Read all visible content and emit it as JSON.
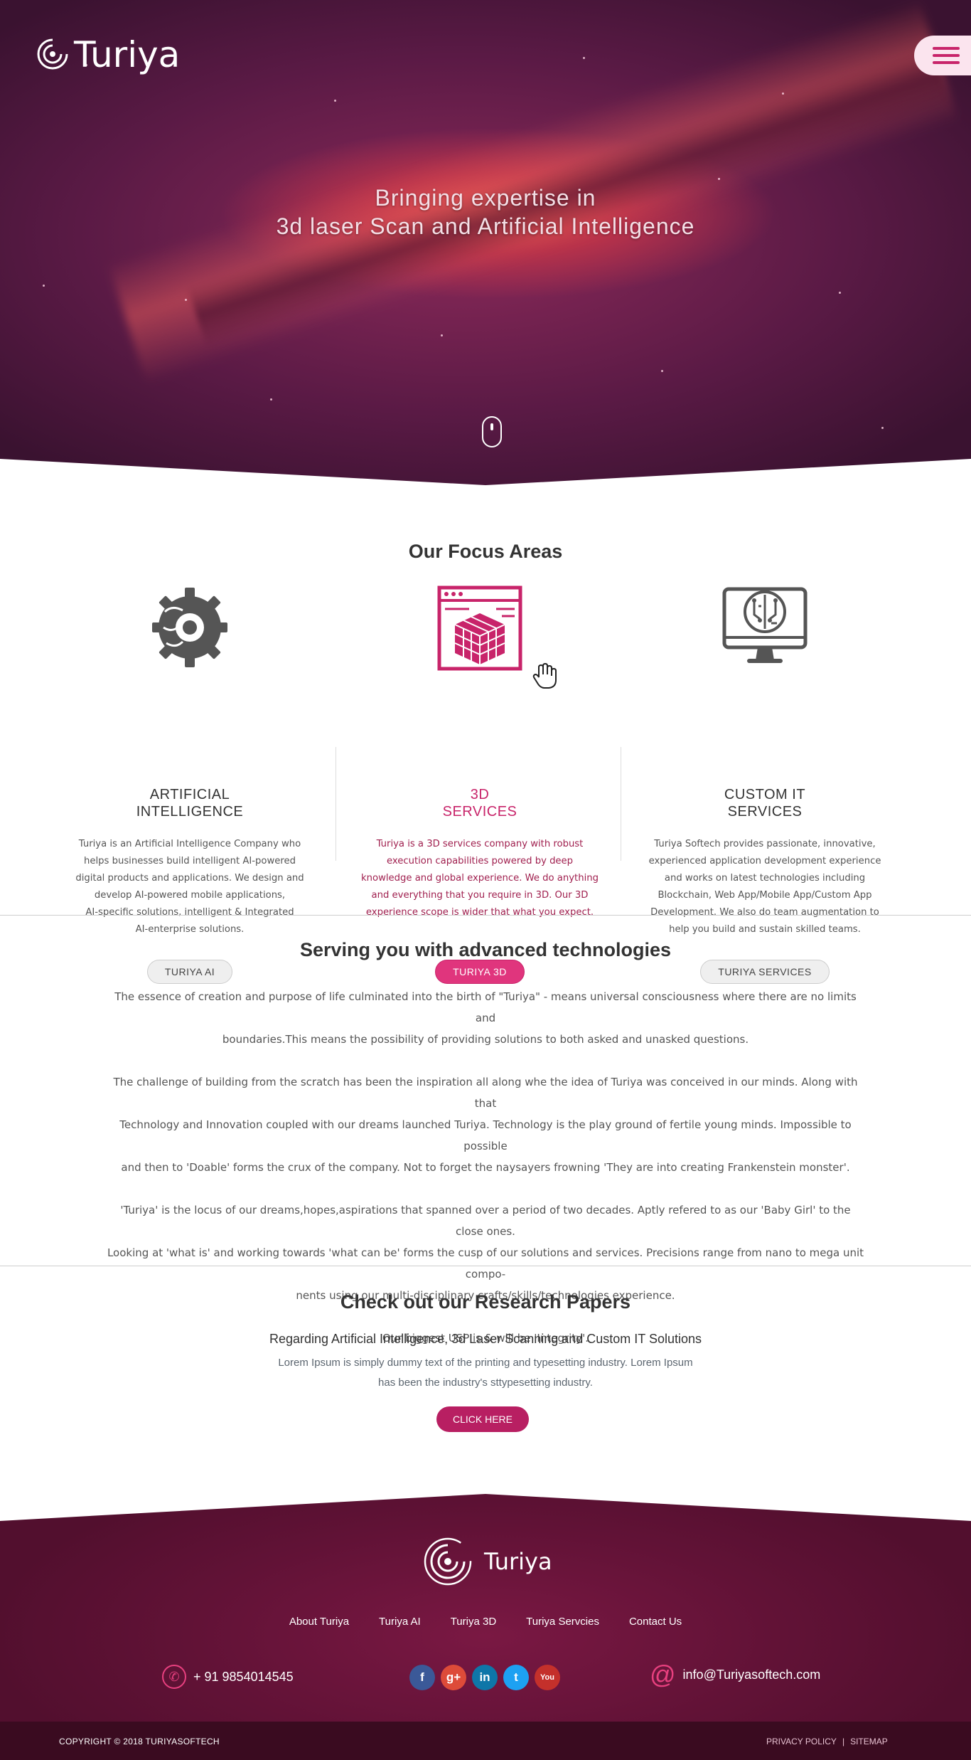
{
  "header": {
    "brand": "Turiya",
    "hero_line1": "Bringing expertise in",
    "hero_line2": "3d laser Scan and Artificial Intelligence"
  },
  "focus": {
    "title": "Our Focus Areas",
    "items": [
      {
        "title_line1": "ARTIFICIAL",
        "title_line2": "INTELLIGENCE",
        "desc_lines": [
          "Turiya is an Artificial Intelligence Company who",
          "helps businesses build intelligent AI-powered",
          "digital products and applications. We design and",
          "develop AI-powered mobile applications,",
          "AI-specific solutions, intelligent & Integrated",
          "AI-enterprise solutions."
        ],
        "button": "TURIYA AI",
        "icon": "ai-brain-gear-icon"
      },
      {
        "title_line1": "3D",
        "title_line2": "SERVICES",
        "desc_lines": [
          "Turiya is a 3D services company with robust",
          "execution capabilities powered by deep",
          "knowledge and global experience. We do anything",
          "and everything that you require in 3D. Our 3D",
          "experience scope is wider that what you expect."
        ],
        "button": "TURIYA 3D",
        "icon": "3d-cube-window-icon"
      },
      {
        "title_line1": "CUSTOM IT",
        "title_line2": "SERVICES",
        "desc_lines": [
          "Turiya Softech provides passionate, innovative,",
          "experienced application development experience",
          "and works on latest technologies including",
          "Blockchain, Web App/Mobile App/Custom App",
          "Development. We also do team augmentation to",
          "help you build and sustain skilled teams."
        ],
        "button": "TURIYA SERVICES",
        "icon": "monitor-circuit-icon"
      }
    ]
  },
  "serving": {
    "title": "Serving you with advanced technologies",
    "paragraphs": [
      [
        "The essence of creation and purpose of life culminated into the birth of \"Turiya\" - means universal consciousness where there are no limits and",
        "boundaries.This means the possibility of providing solutions to both asked and unasked questions."
      ],
      [
        "The challenge of building from the scratch has been the inspiration all along whe the idea of Turiya was conceived in our minds. Along with that",
        "Technology and Innovation coupled with our dreams launched Turiya. Technology is the play ground of fertile young minds. Impossible to possible",
        "and then to 'Doable' forms the crux of the company. Not to forget the naysayers frowning 'They are into creating Frankenstein monster'."
      ],
      [
        "'Turiya' is the locus of our dreams,hopes,aspirations that spanned over a period of two decades. Aptly refered to as our 'Baby Girl' to the close ones.",
        "Looking at 'what is' and working towards 'what can be' forms the cusp of our solutions and services. Precisions range from nano to mega unit compo-",
        "nents using our multi-disciplinary crafts/skills/technologies experience."
      ],
      [
        "Our biggest USP is & will be 'Integrity'."
      ]
    ]
  },
  "research": {
    "title": "Check out our Research Papers",
    "subtitle": "Regarding Artificial Intelligence, 3d Laser Scanning and Custom IT Solutions",
    "desc_line1": "Lorem Ipsum is simply dummy text of the printing and typesetting industry. Lorem Ipsum",
    "desc_line2": "has been the industry's sttypesetting industry.",
    "button": "CLICK HERE"
  },
  "footer": {
    "brand": "Turiya",
    "nav": [
      "About Turiya",
      "Turiya AI",
      "Turiya 3D",
      "Turiya Servcies",
      "Contact Us"
    ],
    "phone": "+ 91 9854014545",
    "email": "info@Turiyasoftech.com",
    "social": [
      {
        "icon": "facebook-icon",
        "glyph": "f",
        "color": "#3b5998"
      },
      {
        "icon": "google-plus-icon",
        "glyph": "g+",
        "color": "#dd4b39"
      },
      {
        "icon": "linkedin-icon",
        "glyph": "in",
        "color": "#0e76a8"
      },
      {
        "icon": "twitter-icon",
        "glyph": "t",
        "color": "#1da1f2"
      },
      {
        "icon": "youtube-icon",
        "glyph": "You",
        "color": "#c4302b"
      }
    ],
    "copyright": "COPYRIGHT ©  2018  TURIYASOFTECH",
    "privacy": "PRIVACY POLICY",
    "separator": "|",
    "sitemap": "SITEMAP"
  },
  "colors": {
    "brand": "#c8246a",
    "footer_bg": "#611236"
  }
}
